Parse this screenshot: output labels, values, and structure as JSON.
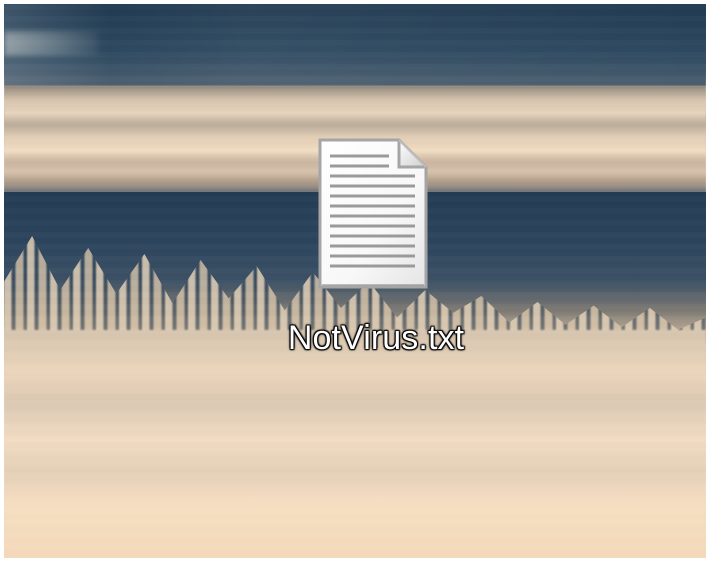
{
  "desktop": {
    "background_colors": {
      "water": "#2c4358",
      "sand": "#e8d2b8",
      "horizon": "#d8c6af"
    },
    "icons": [
      {
        "label": "NotVirus.txt",
        "icon": "text-file-icon"
      }
    ]
  }
}
